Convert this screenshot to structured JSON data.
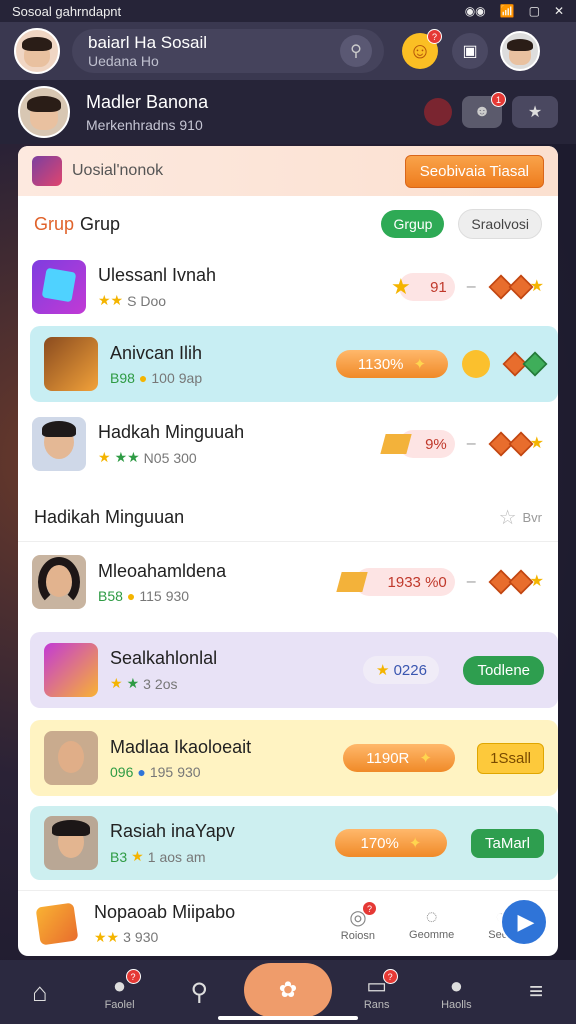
{
  "status_bar": {
    "title": "Sosoal gahrndapnt"
  },
  "header": {
    "name": "baiarl Ha Sosail",
    "sub": "Uedana Ho"
  },
  "profile": {
    "name": "Madler Banona",
    "sub": "Merkenhradns 910"
  },
  "card": {
    "top_title": "Uosial'nonok",
    "top_button": "Seobivaia Tiasal",
    "group_title_a": "Grup",
    "group_title_b": "Grup",
    "chip_active": "Grgup",
    "chip_inactive": "Sraolvosi",
    "section_title": "Hadikah Minguuan",
    "section_meta": "Bvr"
  },
  "rows": [
    {
      "name": "Ulessanl Ivnah",
      "sub": "S Doo",
      "pill": "91"
    },
    {
      "name": "Anivcan Ilih",
      "sub_a": "B98",
      "sub_b": "100",
      "sub_c": "9ap",
      "pill": "1130%"
    },
    {
      "name": "Hadkah Minguuah",
      "sub": "N05",
      "sub_b": "300",
      "pill": "9%"
    },
    {
      "name": "Mleoahamldena",
      "sub_a": "B58",
      "sub_b": "115",
      "sub_c": "930",
      "pill": "1933 %0"
    },
    {
      "name": "Sealkahlonlal",
      "sub": "3",
      "sub_b": "2os",
      "pill": "0226",
      "button": "Todlene"
    },
    {
      "name": "Madlaa Ikaoloeait",
      "sub_a": "096",
      "sub_b": "195",
      "sub_c": "930",
      "pill": "1190R",
      "button": "1Ssall"
    },
    {
      "name": "Rasiah inaYapv",
      "sub_a": "B3",
      "sub_b": "1",
      "sub_c": "aos",
      "sub_d": "am",
      "pill": "170%",
      "button": "TaMarl"
    },
    {
      "name": "Nopaoab Miipabo",
      "sub": "3",
      "sub_b": "930"
    }
  ],
  "footer_tabs": [
    "Roiosn",
    "Geomme",
    "Seon"
  ],
  "nav": [
    "Faolel",
    "Rans",
    "Haolls"
  ],
  "colors": {
    "accent": "#ee7c1e",
    "green": "#2e9e4f",
    "nav_bg": "#2b2940"
  }
}
